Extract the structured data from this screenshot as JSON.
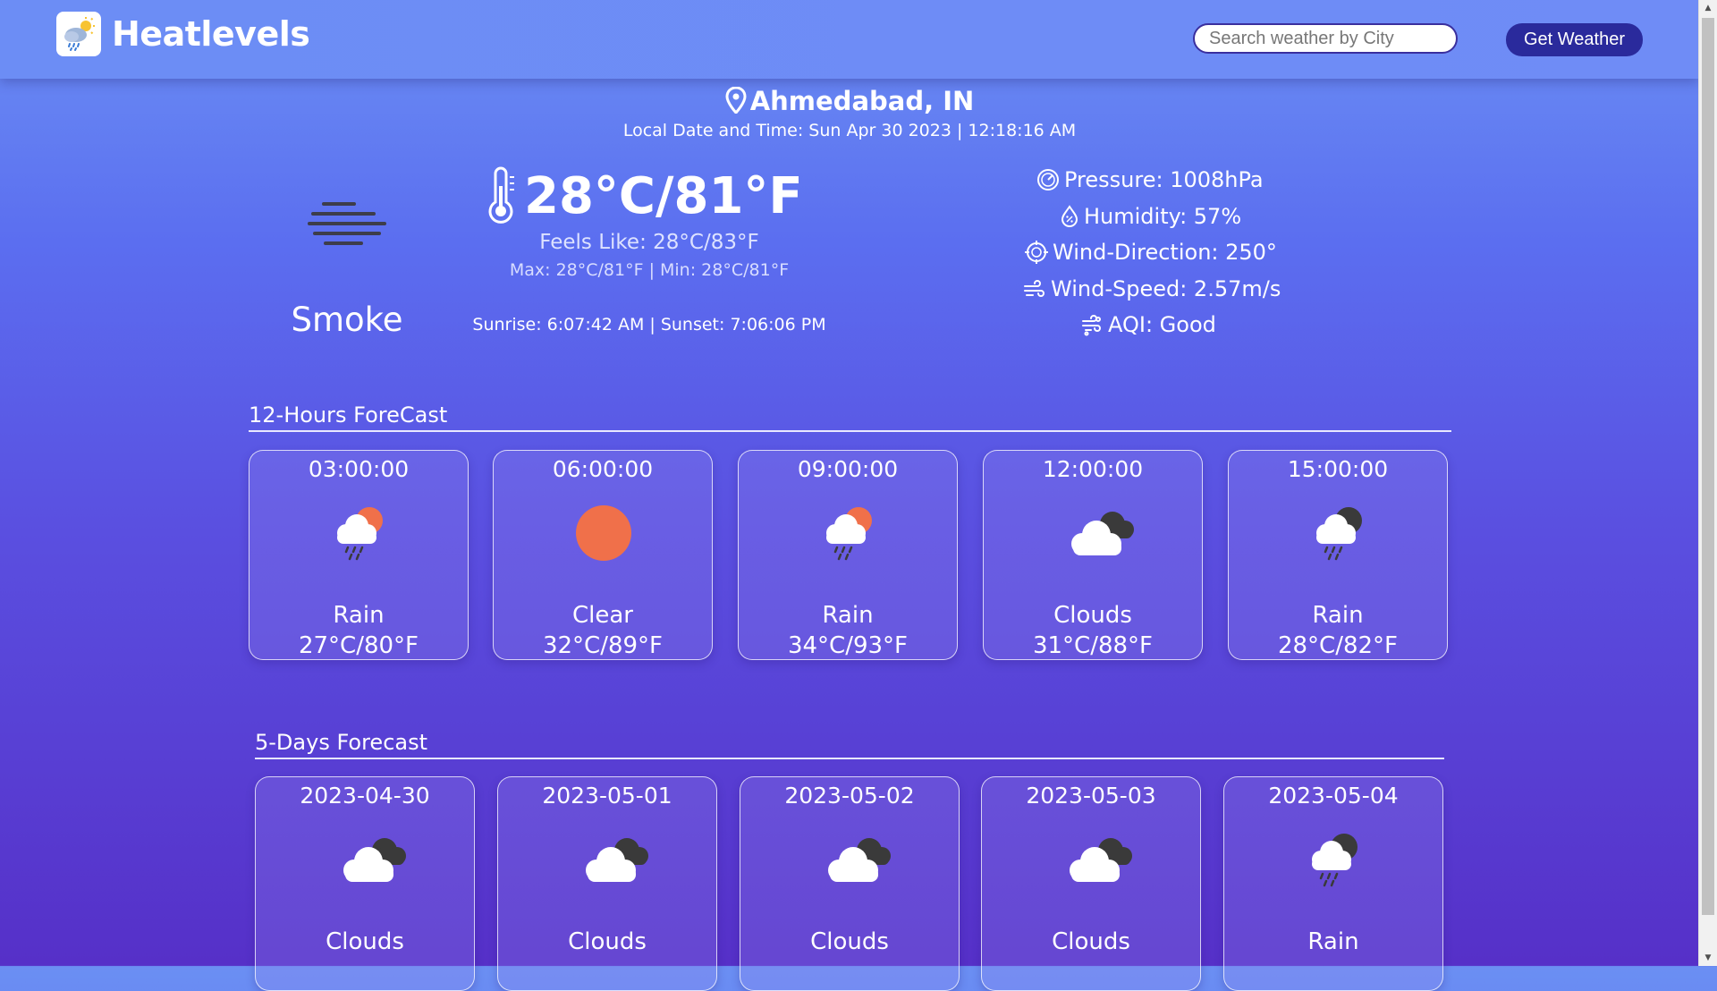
{
  "header": {
    "brand": "Heatlevels",
    "search_placeholder": "Search weather by City",
    "button_label": "Get Weather"
  },
  "current": {
    "location": "Ahmedabad, IN",
    "local_time": "Local Date and Time: Sun Apr 30 2023 | 12:18:16 AM",
    "condition": "Smoke",
    "temperature": "28°C/81°F",
    "feels_like": "Feels Like: 28°C/83°F",
    "max_min": "Max: 28°C/81°F | Min: 28°C/81°F",
    "sun": "Sunrise: 6:07:42 AM | Sunset: 7:06:06 PM",
    "pressure": "Pressure: 1008hPa",
    "humidity": "Humidity: 57%",
    "wind_direction": "Wind-Direction: 250°",
    "wind_speed": "Wind-Speed: 2.57m/s",
    "aqi": "AQI: Good"
  },
  "hourly": {
    "title": "12-Hours ForeCast",
    "items": [
      {
        "time": "03:00:00",
        "icon": "rain-sun-icon",
        "condition": "Rain",
        "temp": "27°C/80°F"
      },
      {
        "time": "06:00:00",
        "icon": "sun-icon",
        "condition": "Clear",
        "temp": "32°C/89°F"
      },
      {
        "time": "09:00:00",
        "icon": "rain-sun-icon",
        "condition": "Rain",
        "temp": "34°C/93°F"
      },
      {
        "time": "12:00:00",
        "icon": "clouds-icon",
        "condition": "Clouds",
        "temp": "31°C/88°F"
      },
      {
        "time": "15:00:00",
        "icon": "rain-cloud-icon",
        "condition": "Rain",
        "temp": "28°C/82°F"
      }
    ]
  },
  "daily": {
    "title": "5-Days Forecast",
    "items": [
      {
        "date": "2023-04-30",
        "icon": "clouds-icon",
        "condition": "Clouds"
      },
      {
        "date": "2023-05-01",
        "icon": "clouds-icon",
        "condition": "Clouds"
      },
      {
        "date": "2023-05-02",
        "icon": "clouds-icon",
        "condition": "Clouds"
      },
      {
        "date": "2023-05-03",
        "icon": "clouds-icon",
        "condition": "Clouds"
      },
      {
        "date": "2023-05-04",
        "icon": "rain-cloud-icon",
        "condition": "Rain"
      }
    ]
  },
  "colors": {
    "accent_button": "#2a2a9c",
    "sun": "#f0704a",
    "dark_cloud": "#3a3a3a"
  }
}
